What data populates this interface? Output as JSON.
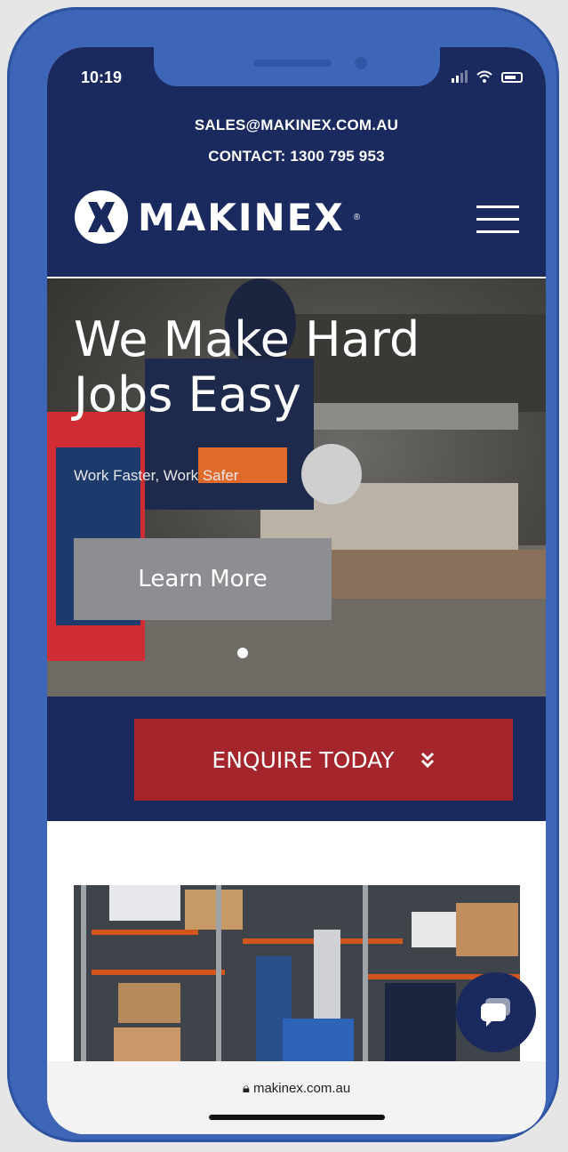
{
  "status_bar": {
    "time": "10:19"
  },
  "header": {
    "email": "SALES@MAKINEX.COM.AU",
    "contact": "CONTACT: 1300 795 953",
    "logo_text": "MAKINEX"
  },
  "hero": {
    "title": "We Make Hard Jobs Easy",
    "subtitle": "Work Faster, Work Safer",
    "cta_label": "Learn More",
    "slide_index": 1
  },
  "enquire": {
    "label": "ENQUIRE TODAY"
  },
  "browser": {
    "url": "makinex.com.au"
  },
  "colors": {
    "navy": "#1b2a5e",
    "red": "#a4262c",
    "grey_button": "#8d8e92",
    "phone_frame": "#3d66b8"
  },
  "icons": [
    "signal-icon",
    "wifi-icon",
    "battery-icon",
    "menu-icon",
    "chevron-double-down-icon",
    "chat-icon",
    "lock-icon"
  ]
}
